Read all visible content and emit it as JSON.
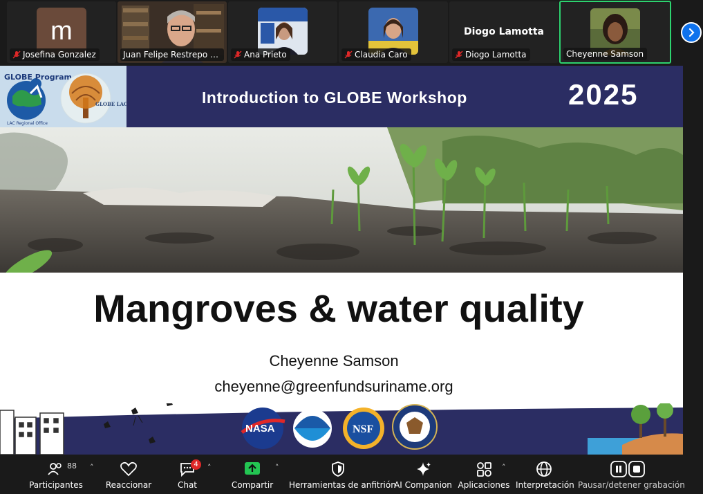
{
  "participants": [
    {
      "name": "Josefina Gonzalez",
      "muted": true,
      "avatar_letter": "m"
    },
    {
      "name": "Juan Felipe Restrepo Me...",
      "muted": false
    },
    {
      "name": "Ana Prieto",
      "muted": true
    },
    {
      "name": "Claudia Caro",
      "muted": true
    },
    {
      "name": "Diogo Lamotta",
      "muted": true,
      "display_name": "Diogo Lamotta"
    },
    {
      "name": "Cheyenne Samson",
      "muted": false,
      "active_speaker": true
    }
  ],
  "slide": {
    "header_title": "Introduction to GLOBE Workshop",
    "header_year": "2025",
    "logo_globe_text": "GLOBE Program",
    "logo_globe_sub": "LAC Regional Office",
    "logo_tree_text": "GLOBE LAC",
    "main_title": "Mangroves & water quality",
    "author": "Cheyenne Samson",
    "email": "cheyenne@greenfundsuriname.org",
    "footer_logos": [
      "NASA",
      "NOAA",
      "NSF",
      "DEPARTMENT OF STATE UNITED STATES OF AMERICA"
    ]
  },
  "toolbar": {
    "participants_label": "Participantes",
    "participants_count": "88",
    "react_label": "Reaccionar",
    "chat_label": "Chat",
    "chat_badge": "4",
    "share_label": "Compartir",
    "host_tools_label": "Herramientas de anfitrión",
    "ai_label": "AI Companion",
    "apps_label": "Aplicaciones",
    "interp_label": "Interpretación",
    "record_label": "Pausar/detener grabación"
  },
  "colors": {
    "slide_header": "#2b2d63",
    "active_border": "#2dd36f",
    "share_green": "#23c552",
    "badge_red": "#e02828",
    "accent_blue": "#0e72ed"
  }
}
